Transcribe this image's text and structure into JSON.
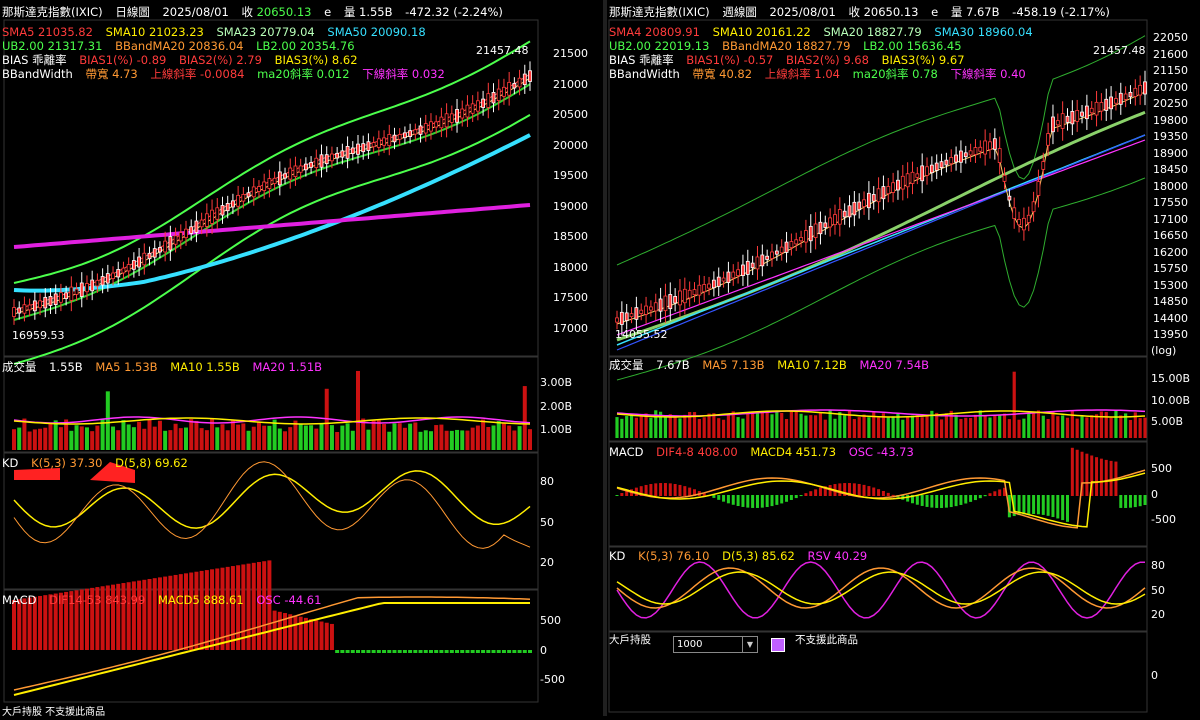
{
  "colors": {
    "background": "#000000",
    "red": "#ff3b3b",
    "green": "#4cff4c",
    "yellow": "#ffee00",
    "cyan": "#36e0ff",
    "magenta": "#ff33ff",
    "orange": "#ff9933",
    "label": "#ffffff"
  },
  "left": {
    "title_bar": "那斯達克指數(IXIC)",
    "period": "日線圖",
    "date": "2025/08/01",
    "close_label": "收",
    "close": "20650.13",
    "e": "e",
    "vol_label": "量",
    "vol": "1.55B",
    "change": "-472.32 (-2.24%)",
    "row1": {
      "sma5": "SMA5 21035.82",
      "sma10": "SMA10 21023.23",
      "sma23": "SMA23 20779.04",
      "sma50": "SMA50 20090.18"
    },
    "row2": {
      "ub": "UB2.00 21317.31",
      "bbandma": "BBandMA20 20836.04",
      "lb": "LB2.00 20354.76"
    },
    "row3": {
      "bias_label": "BIAS 乖離率",
      "bias1": "BIAS1(%) -0.89",
      "bias2": "BIAS2(%) 2.79",
      "bias3": "BIAS3(%) 8.62"
    },
    "row4": {
      "bbw_label": "BBandWidth",
      "width": "帶寬 4.73",
      "upper": "上線斜率 -0.0084",
      "ma20": "ma20斜率 0.012",
      "lower": "下線斜率 0.032"
    },
    "price_axis": [
      "21500",
      "21000",
      "20500",
      "20000",
      "19500",
      "19000",
      "18500",
      "18000",
      "17500",
      "17000"
    ],
    "high_label": "21457.48",
    "low_label": "16959.53",
    "volume": {
      "label": "成交量",
      "vol": "1.55B",
      "ma5": "MA5 1.53B",
      "ma10": "MA10 1.55B",
      "ma20": "MA20 1.51B",
      "axis": [
        "3.00B",
        "2.00B",
        "1.00B"
      ]
    },
    "kd": {
      "label": "KD",
      "k": "K(5,3) 37.30",
      "d": "D(5,8) 69.62",
      "axis": [
        "80",
        "50",
        "20"
      ]
    },
    "macd": {
      "label": "MACD",
      "dif": "DIF14-53 843.99",
      "macd": "MACD5 888.61",
      "osc": "OSC -44.61",
      "axis": [
        "500",
        "0",
        "-500"
      ]
    },
    "footer": "大戶持股  不支援此商品"
  },
  "right": {
    "title_bar": "那斯達克指數(IXIC)",
    "period": "週線圖",
    "date": "2025/08/01",
    "close_label": "收",
    "close": "20650.13",
    "e": "e",
    "vol_label": "量",
    "vol": "7.67B",
    "change": "-458.19 (-2.17%)",
    "row1": {
      "sma4": "SMA4 20809.91",
      "sma10": "SMA10 20161.22",
      "sma20": "SMA20 18827.79",
      "sma30": "SMA30 18960.04"
    },
    "row2": {
      "ub": "UB2.00 22019.13",
      "bbandma": "BBandMA20 18827.79",
      "lb": "LB2.00 15636.45"
    },
    "row3": {
      "bias_label": "BIAS 乖離率",
      "bias1": "BIAS1(%) -0.57",
      "bias2": "BIAS2(%) 9.68",
      "bias3": "BIAS3(%) 9.67"
    },
    "row4": {
      "bbw_label": "BBandWidth",
      "width": "帶寬 40.82",
      "upper": "上線斜率 1.04",
      "ma20": "ma20斜率 0.78",
      "lower": "下線斜率 0.40"
    },
    "price_axis": [
      "22050",
      "21600",
      "21150",
      "20700",
      "20250",
      "19800",
      "19350",
      "18900",
      "18450",
      "18000",
      "17550",
      "17100",
      "16650",
      "16200",
      "15750",
      "15300",
      "14850",
      "14400",
      "13950"
    ],
    "log_label": "(log)",
    "high_label": "21457.48",
    "low_label": "14055.52",
    "volume": {
      "label": "成交量",
      "vol": "7.67B",
      "ma5": "MA5 7.13B",
      "ma10": "MA10 7.12B",
      "ma20": "MA20 7.54B",
      "axis": [
        "15.00B",
        "10.00B",
        "5.00B"
      ]
    },
    "macd": {
      "label": "MACD",
      "dif": "DIF4-8 408.00",
      "macd": "MACD4 451.73",
      "osc": "OSC -43.73",
      "axis": [
        "500",
        "0",
        "-500"
      ]
    },
    "kd": {
      "label": "KD",
      "k": "K(5,3) 76.10",
      "d": "D(5,3) 85.62",
      "rsv": "RSV 40.29",
      "axis": [
        "80",
        "50",
        "20"
      ]
    },
    "holders": {
      "label": "大戶持股",
      "select_value": "1000",
      "unsupported": "不支援此商品",
      "axis": [
        "0"
      ]
    }
  }
}
